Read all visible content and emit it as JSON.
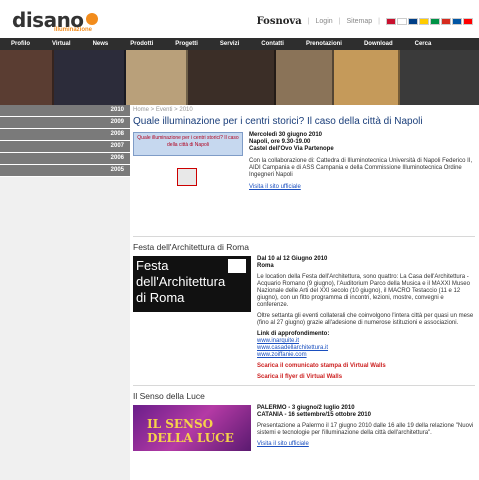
{
  "header": {
    "logo_text": "disano",
    "logo_sub": "illuminazione",
    "brand": "Fosnova",
    "links": [
      "Login",
      "Sitemap"
    ],
    "flags": [
      "#c8102e",
      "#ffffff",
      "#003f87",
      "#ffcc00",
      "#009246",
      "#d52b1e",
      "#0055a4",
      "#ff0000"
    ]
  },
  "nav": {
    "items": [
      "Profilo",
      "Virtual",
      "News",
      "Prodotti",
      "Progetti",
      "Servizi",
      "Contatti",
      "Prenotazioni",
      "Download",
      "Cerca"
    ]
  },
  "sidebar": {
    "years": [
      "2010",
      "2009",
      "2008",
      "2007",
      "2006",
      "2005"
    ]
  },
  "main": {
    "breadcrumb": "Home > Eventi > 2010",
    "event1": {
      "title": "Quale illuminazione per i centri storici? Il caso della città di Napoli",
      "thumb_text": "Quale illuminazione per i centri storici? Il caso della città di Napoli",
      "date_line": "Mercoledì 30 giugno 2010",
      "place_line": "Napoli, ore 9.30-19.00",
      "venue_line": "Castel dell'Ovo Via Partenope",
      "collab": "Con la collaborazione di: Cattedra di Illuminotecnica Università di Napoli Federico II, AIDI Campania e di ASS Campania e della Commissione Illuminotecnica Ordine Ingegneri Napoli",
      "link": "Visita il sito ufficiale"
    },
    "event2": {
      "title": "Festa dell'Architettura di Roma",
      "thumb_l1": "Festa",
      "thumb_l2": "dell'Architettura",
      "thumb_l3": "di Roma",
      "date_line": "Dal 10 al 12 Giugno 2010",
      "place_line": "Roma",
      "body1": "Le location della Festa dell'Architettura, sono quattro: La Casa dell'Architettura - Acquario Romano (9 giugno), l'Auditorium Parco della Musica e il MAXXI Museo Nazionale delle Arti del XXI secolo (10 giugno), il MACRO Testaccio (11 e 12 giugno), con un fitto programma di incontri, lezioni, mostre, convegni e conferenze.",
      "body2": "Oltre settanta gli eventi collaterali che coinvolgono l'intera città per quasi un mese (fino al 27 giugno) grazie all'adesione di numerose istituzioni e associazioni.",
      "links_title": "Link di approfondimento:",
      "links": [
        "www.inarquite.it",
        "www.casadellarchitettura.it",
        "www.zoiffanie.com"
      ],
      "red1": "Scarica il comunicato stampa di Virtual Walls",
      "red2": "Scarica il flyer di Virtual Walls"
    },
    "event3": {
      "title": "Il Senso della Luce",
      "thumb_text": "IL SENSO DELLA LUCE",
      "date1": "PALERMO - 3 giugno/2 luglio 2010",
      "date2": "CATANIA - 16 settembre/15 ottobre 2010",
      "body": "Presentazione a Palermo il 17 giugno 2010 dalle 16 alle 19 della relazione \"Nuovi sistemi e tecnologie per l'illuminazione della città dell'architettura\".",
      "link": "Visita il sito ufficiale"
    }
  }
}
